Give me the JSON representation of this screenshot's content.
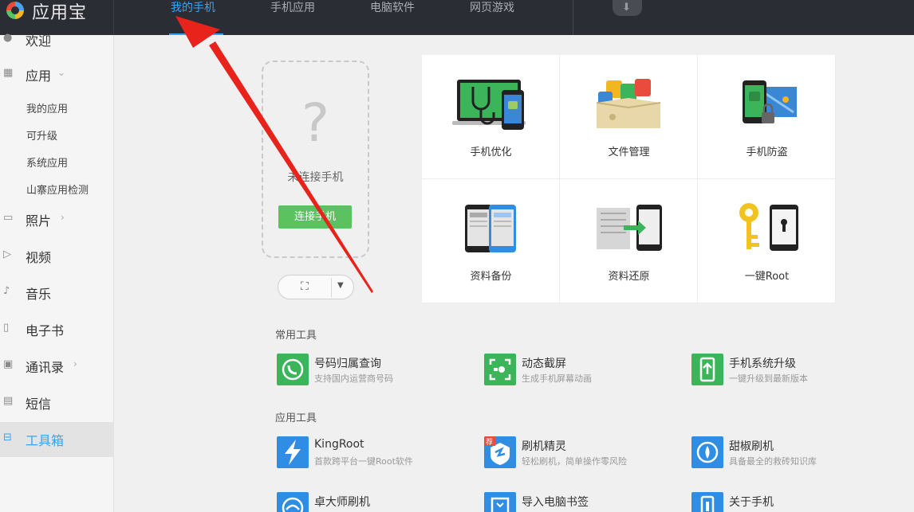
{
  "header": {
    "app_name": "应用宝",
    "tabs": [
      {
        "label": "我的手机",
        "active": true
      },
      {
        "label": "手机应用",
        "active": false
      },
      {
        "label": "电脑软件",
        "active": false
      },
      {
        "label": "网页游戏",
        "active": false
      }
    ],
    "download_icon": "download-arrow-icon"
  },
  "sidebar": {
    "items": [
      {
        "label": "欢迎",
        "icon": "welcome-icon"
      },
      {
        "label": "应用",
        "icon": "apps-grid-icon",
        "expandable": true
      },
      {
        "label": "照片",
        "icon": "photo-icon",
        "expandable": true
      },
      {
        "label": "视频",
        "icon": "video-icon"
      },
      {
        "label": "音乐",
        "icon": "music-icon"
      },
      {
        "label": "电子书",
        "icon": "ebook-icon"
      },
      {
        "label": "通讯录",
        "icon": "contacts-icon",
        "expandable": true
      },
      {
        "label": "短信",
        "icon": "sms-icon"
      },
      {
        "label": "工具箱",
        "icon": "toolbox-icon",
        "active": true
      }
    ],
    "app_subitems": [
      "我的应用",
      "可升级",
      "系统应用",
      "山寨应用检测"
    ]
  },
  "phone_panel": {
    "question_mark": "?",
    "status": "未连接手机",
    "connect_label": "连接手机"
  },
  "features": [
    {
      "label": "手机优化",
      "icon": "phone-optimize-icon"
    },
    {
      "label": "文件管理",
      "icon": "file-manager-icon"
    },
    {
      "label": "手机防盗",
      "icon": "anti-theft-icon"
    },
    {
      "label": "资料备份",
      "icon": "data-backup-icon"
    },
    {
      "label": "资料还原",
      "icon": "data-restore-icon"
    },
    {
      "label": "一键Root",
      "icon": "one-click-root-icon"
    }
  ],
  "common_tools": {
    "title": "常用工具",
    "items": [
      {
        "name": "号码归属查询",
        "desc": "支持国内运营商号码",
        "color": "#3cb55a"
      },
      {
        "name": "动态截屏",
        "desc": "生成手机屏幕动画",
        "color": "#3cb55a"
      },
      {
        "name": "手机系统升级",
        "desc": "一键升级到最新版本",
        "color": "#3cb55a"
      }
    ]
  },
  "app_tools": {
    "title": "应用工具",
    "items": [
      {
        "name": "KingRoot",
        "desc": "首款跨平台一键Root软件",
        "color": "#2f8de4"
      },
      {
        "name": "刷机精灵",
        "desc": "轻松刷机，简单操作零风险",
        "color": "#2f8de4",
        "badge": "荐"
      },
      {
        "name": "甜椒刷机",
        "desc": "具备最全的救砖知识库",
        "color": "#2f8de4"
      },
      {
        "name": "卓大师刷机",
        "desc": "",
        "color": "#2f8de4"
      },
      {
        "name": "导入电脑书签",
        "desc": "",
        "color": "#2f8de4"
      },
      {
        "name": "关于手机",
        "desc": "",
        "color": "#2f8de4"
      }
    ]
  },
  "colors": {
    "accent": "#37a3f2",
    "connect_green": "#5ac25f",
    "topbar": "#2b2d34",
    "annotation_arrow": "#e8231c"
  }
}
